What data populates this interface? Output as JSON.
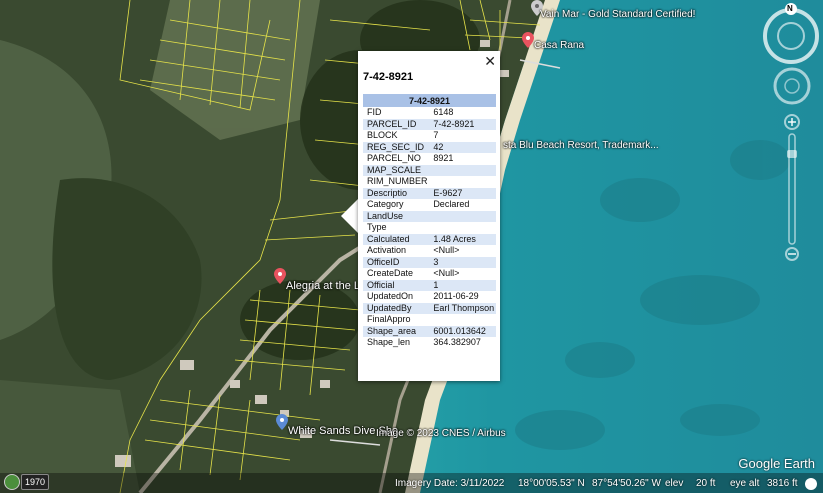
{
  "popup": {
    "title": "7-42-8921",
    "header": "7-42-8921",
    "close_glyph": "✕",
    "rows": [
      {
        "key": "FID",
        "value": "6148"
      },
      {
        "key": "PARCEL_ID",
        "value": "7-42-8921"
      },
      {
        "key": "BLOCK",
        "value": "7"
      },
      {
        "key": "REG_SEC_ID",
        "value": "42"
      },
      {
        "key": "PARCEL_NO",
        "value": "8921"
      },
      {
        "key": "MAP_SCALE",
        "value": ""
      },
      {
        "key": "RIM_NUMBER",
        "value": ""
      },
      {
        "key": "Descriptio",
        "value": "E-9627"
      },
      {
        "key": "Category",
        "value": "Declared"
      },
      {
        "key": "LandUse",
        "value": ""
      },
      {
        "key": "Type",
        "value": ""
      },
      {
        "key": "Calculated",
        "value": "1.48 Acres"
      },
      {
        "key": "Activation",
        "value": "<Null>"
      },
      {
        "key": "OfficeID",
        "value": "3"
      },
      {
        "key": "CreateDate",
        "value": "<Null>"
      },
      {
        "key": "Official",
        "value": "1"
      },
      {
        "key": "UpdatedOn",
        "value": "2011-06-29"
      },
      {
        "key": "UpdatedBy",
        "value": "Earl Thompson"
      },
      {
        "key": "FinalAppro",
        "value": ""
      },
      {
        "key": "Shape_area",
        "value": "6001.013642"
      },
      {
        "key": "Shape_len",
        "value": "364.382907"
      }
    ]
  },
  "places": {
    "gold_standard": "Vain Mar - Gold Standard Certified!",
    "casa_rana": "Casa Rana",
    "beach_resort": "sta Blu Beach Resort, Trademark...",
    "alegria": "Alegria at the La",
    "white_sands": "White Sands Dive Sho"
  },
  "imagery_credit": "Image © 2023 CNES / Airbus",
  "status": {
    "imagery_date": "Imagery Date: 3/11/2022",
    "lat": "18°00'05.53\" N",
    "lon": "87°54'50.26\" W",
    "elev_label": "elev",
    "elev_value": "20 ft",
    "eye_label": "eye alt",
    "eye_value": "3816 ft"
  },
  "year_button": "1970",
  "logo": "Google Earth",
  "compass_letter": "N",
  "colors": {
    "popup_header": "#a9c1e6",
    "popup_row_alt": "#dce7f6",
    "parcel_lines": "#e6e34a",
    "sea": "#2aa5a8",
    "land": "#3b4a30"
  }
}
